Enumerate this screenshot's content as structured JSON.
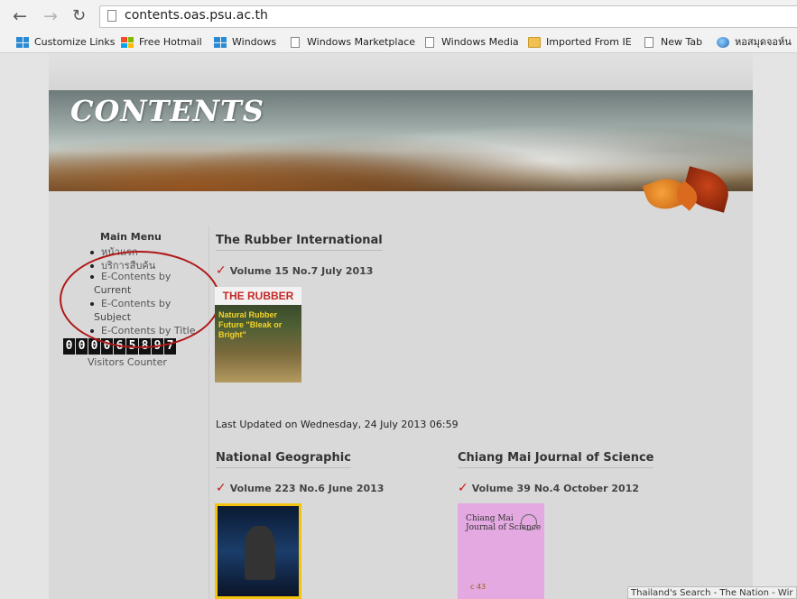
{
  "browser": {
    "url": "contents.oas.psu.ac.th",
    "bookmarks": [
      {
        "label": "Customize Links",
        "icon": "windows-icon"
      },
      {
        "label": "Free Hotmail",
        "icon": "msn-icon"
      },
      {
        "label": "Windows",
        "icon": "windows-icon"
      },
      {
        "label": "Windows Marketplace",
        "icon": "page-icon"
      },
      {
        "label": "Windows Media",
        "icon": "page-icon"
      },
      {
        "label": "Imported From IE",
        "icon": "folder-icon"
      },
      {
        "label": "New Tab",
        "icon": "page-icon"
      },
      {
        "label": "หอสมุดจอห์น",
        "icon": "globe-icon"
      }
    ],
    "status_text": "Thailand's Search - The Nation - Wir"
  },
  "banner": {
    "title": "CONTENTS"
  },
  "sidebar": {
    "title": "Main Menu",
    "items": [
      {
        "label": "หน้าแรก"
      },
      {
        "label": "บริการสืบค้น"
      },
      {
        "label": "E-Contents by",
        "continuation": "Current"
      },
      {
        "label": "E-Contents by",
        "continuation": "Subject"
      },
      {
        "label": "E-Contents by Title"
      }
    ],
    "counter_digits": [
      "0",
      "0",
      "0",
      "0",
      "6",
      "5",
      "8",
      "9",
      "7"
    ],
    "counter_label": "Visitors Counter"
  },
  "main": {
    "featured": {
      "title": "The Rubber International",
      "volume": "Volume 15 No.7 July 2013",
      "cover_heading": "THE RUBBER",
      "cover_subtitle": "Natural Rubber Future \"Bleak or Bright\""
    },
    "last_updated": "Last Updated on Wednesday, 24 July 2013 06:59",
    "journals": [
      {
        "title": "National Geographic",
        "volume": "Volume 223 No.6 June 2013"
      },
      {
        "title": "Chiang Mai Journal of Science",
        "volume": "Volume 39 No.4 October 2012",
        "cover_text": "Chiang Mai Journal of Science",
        "cover_footer": "c 43"
      }
    ]
  },
  "colors": {
    "check": "#c41a1a",
    "annotation_circle": "#b01818"
  }
}
